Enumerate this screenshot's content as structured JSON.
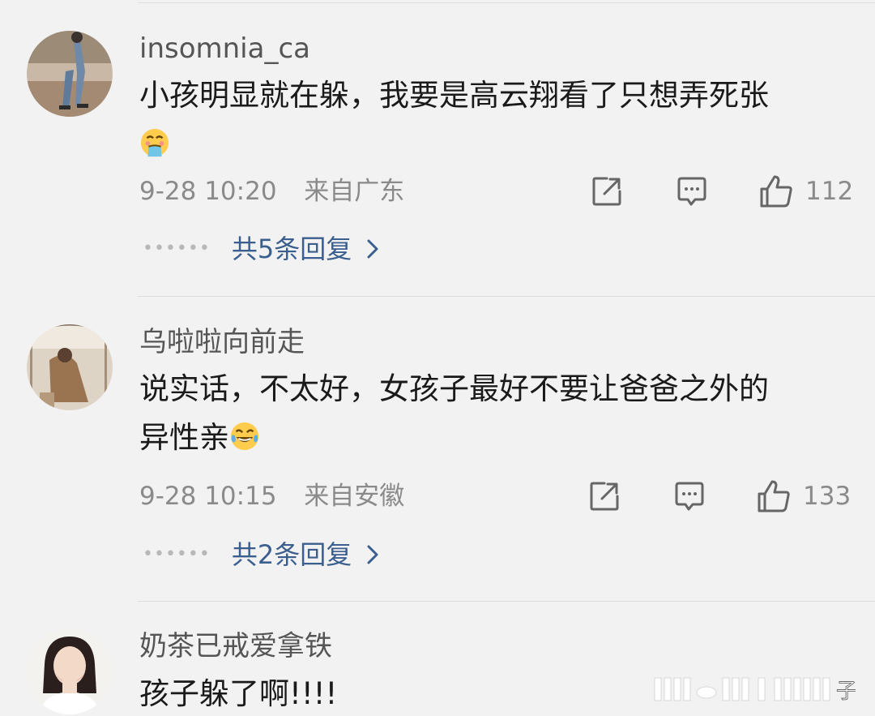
{
  "comments": [
    {
      "username": "insomnia_ca",
      "text": "小孩明显就在躲，我要是高云翔看了只想弄死张",
      "emoji": "vomiting-emoji",
      "time": "9-28 10:20",
      "location": "来自广东",
      "likes": "112",
      "replies": "共5条回复"
    },
    {
      "username": "乌啦啦向前走",
      "text_line1": "说实话，不太好，女孩子最好不要让爸爸之外的",
      "text_line2": "异性亲",
      "emoji": "laughing-tears-emoji",
      "time": "9-28 10:15",
      "location": "来自安徽",
      "likes": "133",
      "replies": "共2条回复"
    },
    {
      "username": "奶茶已戒爱拿铁",
      "text": "孩子躲了啊!!!!"
    }
  ],
  "watermark": {
    "char": "子"
  },
  "colors": {
    "background": "#f2f2f2",
    "username": "#555555",
    "text": "#1a1a1a",
    "meta": "#8a8a8a",
    "reply_link": "#3a5f8f",
    "divider": "#dedede"
  }
}
